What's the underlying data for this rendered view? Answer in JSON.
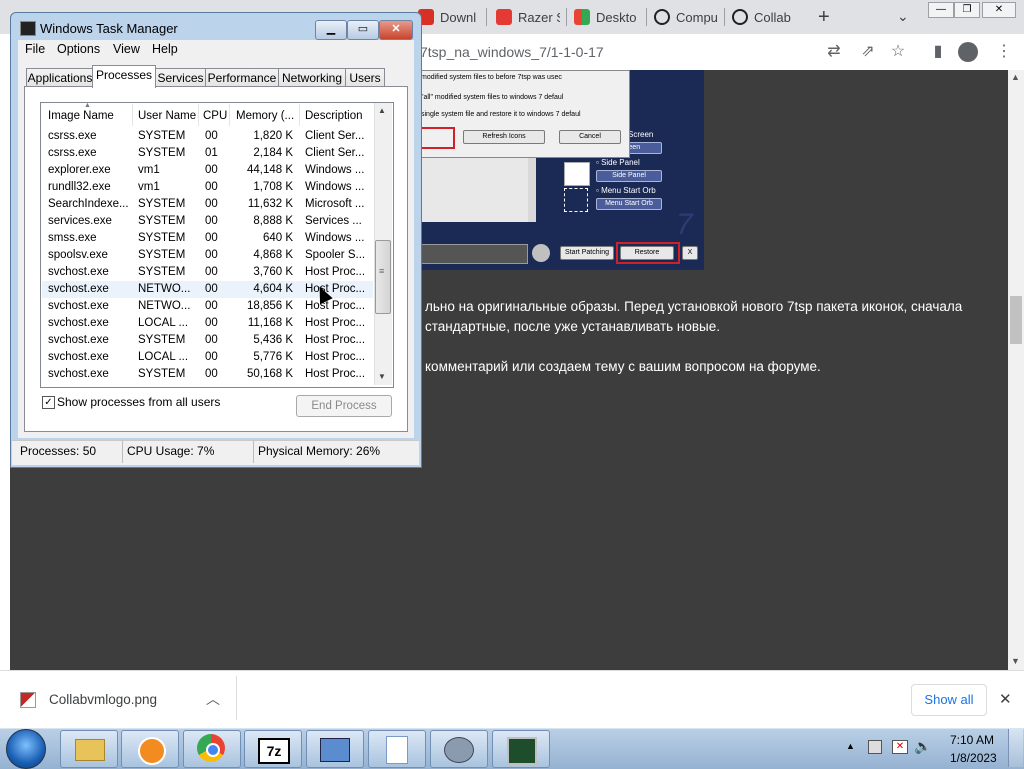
{
  "browser": {
    "tabs": [
      {
        "label": "Downl",
        "color": "#d93025"
      },
      {
        "label": "Razer S",
        "color": "#e53935"
      },
      {
        "label": "Deskto",
        "color": "#4285f4"
      },
      {
        "label": "Compu",
        "color": "#202124"
      },
      {
        "label": "Collab",
        "color": "#202124"
      }
    ],
    "new_tab": "+",
    "url": "7tsp_na_windows_7/1-1-0-17",
    "window_controls": {
      "minimize": "—",
      "restore": "❐",
      "close": "✕"
    }
  },
  "page": {
    "embedded_dialog": {
      "lines": [
        "modified system files to before 7tsp was usec",
        "\"all\" modified system files to windows 7 defaul",
        "single system file and restore it to windows 7 defaul"
      ],
      "refresh_icons": "Refresh Icons",
      "cancel": "Cancel"
    },
    "embedded_panel": {
      "screen_label": "Screen",
      "screen_btn": "Screen",
      "side_panel_label": "Side Panel",
      "side_panel_btn": "Side Panel",
      "menu_start_orb_label": "Menu Start Orb",
      "menu_start_orb_btn": "Menu Start Orb",
      "start_patching": "Start Patching",
      "restore": "Restore",
      "x": "X",
      "seven": "7"
    },
    "paragraph_lines": [
      "льно на оригинальные образы. Перед установкой нового 7tsp пакета иконок, сначала",
      "стандартные, после уже устанавливать новые.",
      "комментарий или создаем тему с вашим вопросом на форуме."
    ]
  },
  "download_bar": {
    "file_name": "Collabvmlogo.png",
    "show_all": "Show all",
    "close": "✕"
  },
  "task_manager": {
    "title": "Windows Task Manager",
    "menu": [
      "File",
      "Options",
      "View",
      "Help"
    ],
    "tabs": [
      "Applications",
      "Processes",
      "Services",
      "Performance",
      "Networking",
      "Users"
    ],
    "active_tab": "Processes",
    "columns": [
      "Image Name",
      "User Name",
      "CPU",
      "Memory (...",
      "Description"
    ],
    "rows": [
      [
        "csrss.exe",
        "SYSTEM",
        "00",
        "1,820 K",
        "Client Ser..."
      ],
      [
        "csrss.exe",
        "SYSTEM",
        "01",
        "2,184 K",
        "Client Ser..."
      ],
      [
        "explorer.exe",
        "vm1",
        "00",
        "44,148 K",
        "Windows ..."
      ],
      [
        "rundll32.exe",
        "vm1",
        "00",
        "1,708 K",
        "Windows ..."
      ],
      [
        "SearchIndexe...",
        "SYSTEM",
        "00",
        "11,632 K",
        "Microsoft ..."
      ],
      [
        "services.exe",
        "SYSTEM",
        "00",
        "8,888 K",
        "Services ..."
      ],
      [
        "smss.exe",
        "SYSTEM",
        "00",
        "640 K",
        "Windows ..."
      ],
      [
        "spoolsv.exe",
        "SYSTEM",
        "00",
        "4,868 K",
        "Spooler S..."
      ],
      [
        "svchost.exe",
        "SYSTEM",
        "00",
        "3,760 K",
        "Host Proc..."
      ],
      [
        "svchost.exe",
        "NETWO...",
        "00",
        "4,604 K",
        "Host Proc..."
      ],
      [
        "svchost.exe",
        "NETWO...",
        "00",
        "18,856 K",
        "Host Proc..."
      ],
      [
        "svchost.exe",
        "LOCAL ...",
        "00",
        "11,168 K",
        "Host Proc..."
      ],
      [
        "svchost.exe",
        "SYSTEM",
        "00",
        "5,436 K",
        "Host Proc..."
      ],
      [
        "svchost.exe",
        "LOCAL ...",
        "00",
        "5,776 K",
        "Host Proc..."
      ],
      [
        "svchost.exe",
        "SYSTEM",
        "00",
        "50,168 K",
        "Host Proc..."
      ]
    ],
    "show_all_users": "Show processes from all users",
    "end_process": "End Process",
    "status": {
      "processes": "Processes: 50",
      "cpu": "CPU Usage: 7%",
      "memory": "Physical Memory: 26%"
    }
  },
  "taskbar": {
    "time": "7:10 AM",
    "date": "1/8/2023"
  }
}
